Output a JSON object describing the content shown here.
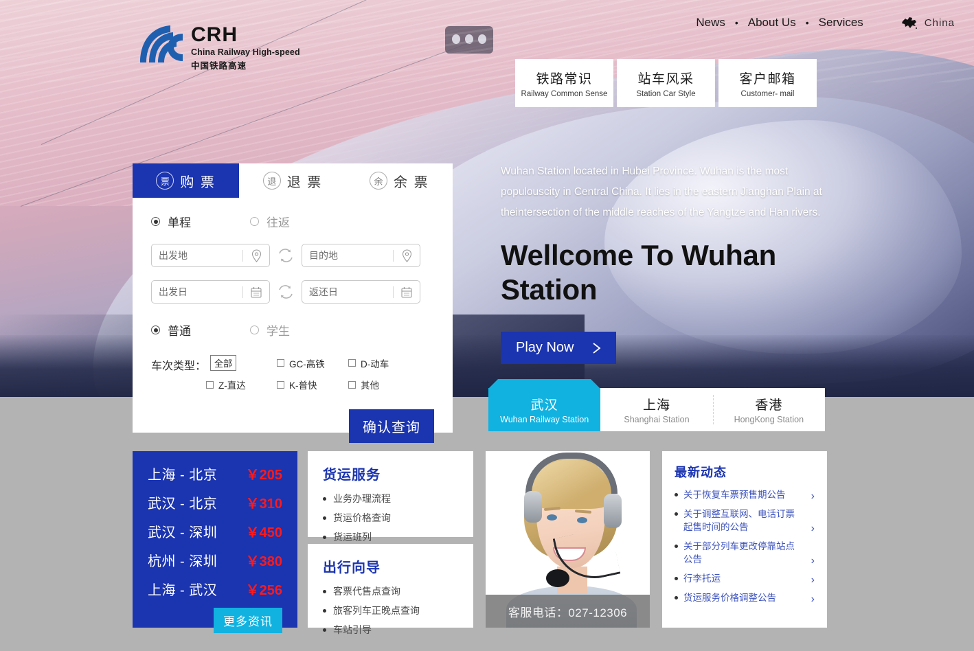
{
  "brand": {
    "abbr": "CRH",
    "name_en": "China Railway High-speed",
    "name_cn": "中国铁路高速"
  },
  "topnav": {
    "items": [
      {
        "label": "News"
      },
      {
        "label": "About Us"
      },
      {
        "label": "Services"
      }
    ],
    "separator": "•",
    "language": {
      "label": "China",
      "icon": "china-map-icon"
    }
  },
  "top_cards": [
    {
      "cn": "铁路常识",
      "en": "Railway Common Sense"
    },
    {
      "cn": "站车风采",
      "en": "Station Car Style"
    },
    {
      "cn": "客户邮箱",
      "en": "Customer- mail"
    }
  ],
  "booking": {
    "tabs": [
      {
        "badge": "票",
        "label": "购 票",
        "active": true
      },
      {
        "badge": "退",
        "label": "退 票",
        "active": false
      },
      {
        "badge": "余",
        "label": "余 票",
        "active": false
      }
    ],
    "trip_options": [
      {
        "label": "单程",
        "selected": true
      },
      {
        "label": "往返",
        "selected": false
      }
    ],
    "fields": {
      "origin_placeholder": "出发地",
      "destination_placeholder": "目的地",
      "depart_date_placeholder": "出发日",
      "return_date_placeholder": "返还日"
    },
    "passenger_options": [
      {
        "label": "普通",
        "selected": true
      },
      {
        "label": "学生",
        "selected": false
      }
    ],
    "train_type_label": "车次类型：",
    "train_type_all": "全部",
    "train_types": [
      {
        "label": "GC-高铁",
        "checked": false
      },
      {
        "label": "D-动车",
        "checked": false
      },
      {
        "label": "Z-直达",
        "checked": false
      },
      {
        "label": "K-普快",
        "checked": false
      },
      {
        "label": "其他",
        "checked": false
      }
    ],
    "confirm_label": "确认查询"
  },
  "hero": {
    "description": "Wuhan Station located in Hubei Province. Wuhan is the most populouscity in Central China. It lies in the eastern Jianghan Plain at theintersection of the middle reaches of the Yangtze and Han rivers.",
    "title": "Wellcome To Wuhan Station",
    "cta_label": "Play Now"
  },
  "stations": [
    {
      "cn": "武汉",
      "en": "Wuhan Railway Station",
      "active": true
    },
    {
      "cn": "上海",
      "en": "Shanghai Station",
      "active": false
    },
    {
      "cn": "香港",
      "en": "HongKong Station",
      "active": false
    }
  ],
  "prices": {
    "rows": [
      {
        "route": "上海 - 北京",
        "amount": "￥205"
      },
      {
        "route": "武汉 - 北京",
        "amount": "￥310"
      },
      {
        "route": "武汉 - 深圳",
        "amount": "￥450"
      },
      {
        "route": "杭州 - 深圳",
        "amount": "￥380"
      },
      {
        "route": "上海 - 武汉",
        "amount": "￥256"
      }
    ],
    "more_label": "更多资讯",
    "accent": "#1b34b0",
    "amount_color": "#ff1a1a",
    "more_color": "#11b2e0"
  },
  "freight": {
    "title": "货运服务",
    "items": [
      "业务办理流程",
      "货运价格查询",
      "货运班列"
    ]
  },
  "travel_guide": {
    "title": "出行向导",
    "items": [
      "客票代售点查询",
      "旅客列车正晚点查询",
      "车站引导"
    ]
  },
  "service_photo": {
    "caption": "客服电话：027-12306"
  },
  "news": {
    "title": "最新动态",
    "items": [
      "关于恢复车票预售期公告",
      "关于调整互联网、电话订票起售时间的公告",
      "关于部分列车更改停靠站点公告",
      "行李托运",
      "货运服务价格调整公告"
    ],
    "chevron": "›"
  },
  "colors": {
    "brand_blue": "#1b34b0",
    "cyan": "#11b2e0",
    "page_bg": "#b3b3b3"
  }
}
